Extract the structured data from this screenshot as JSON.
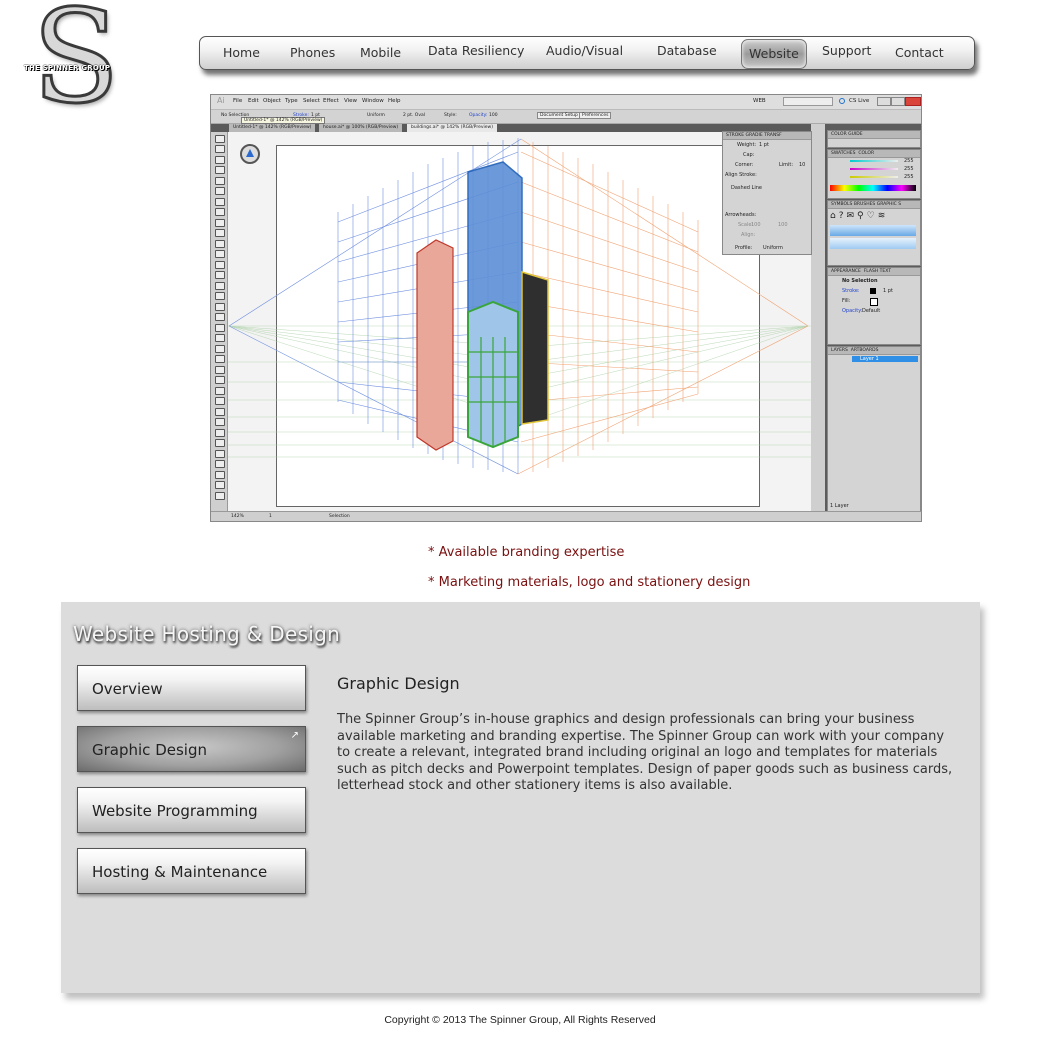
{
  "logo": {
    "letter": "S",
    "company_name": "THE SPINNER GROUP"
  },
  "nav": {
    "items": [
      {
        "label": "Home",
        "active": false
      },
      {
        "label": "Phones",
        "active": false
      },
      {
        "label": "Mobile",
        "active": false
      },
      {
        "label": "Data Resiliency",
        "active": false
      },
      {
        "label": "Audio/Visual",
        "active": false
      },
      {
        "label": "Database",
        "active": false
      },
      {
        "label": "Website",
        "active": true
      },
      {
        "label": "Support",
        "active": false
      },
      {
        "label": "Contact",
        "active": false
      }
    ]
  },
  "illustrator_screenshot": {
    "app_logo": "Ai",
    "menu": [
      "File",
      "Edit",
      "Object",
      "Type",
      "Select",
      "Effect",
      "View",
      "Window",
      "Help"
    ],
    "workspace": "WEB",
    "cs_live": "CS Live",
    "control_bar": {
      "selection": "No Selection",
      "stroke_label": "Stroke:",
      "stroke_weight": "1 pt",
      "profile": "Uniform",
      "brush": "2 pt. Oval",
      "style_label": "Style:",
      "opacity_label": "Opacity:",
      "opacity": "100",
      "document_setup": "Document Setup",
      "preferences": "Preferences"
    },
    "tooltip": "Untitled-1* @ 142% (RGB/Preview)",
    "doc_tabs": [
      "Untitled-1* @ 142% (RGB/Preview)",
      "house.ai* @ 100% (RGB/Preview)",
      "buildings.ai* @ 142% (RGB/Preview)"
    ],
    "stroke_panel": {
      "tabs": [
        "STROKE",
        "GRADIE",
        "TRANSF"
      ],
      "weight_label": "Weight:",
      "weight": "1 pt",
      "cap_label": "Cap:",
      "corner_label": "Corner:",
      "limit_label": "Limit:",
      "limit": "10",
      "align_label": "Align Stroke:",
      "dashed_label": "Dashed Line",
      "arrowheads_label": "Arrowheads:",
      "scale_label": "Scale:",
      "scale1": "100",
      "scale2": "100",
      "align2_label": "Align:",
      "profile_label": "Profile:",
      "profile": "Uniform"
    },
    "color_guide_tab": "COLOR GUIDE",
    "color_panel": {
      "tabs": [
        "SWATCHES",
        "COLOR"
      ],
      "r": "255",
      "g": "255",
      "b": "255"
    },
    "symbols_panel": {
      "tabs": [
        "SYMBOLS",
        "BRUSHES",
        "GRAPHIC S"
      ]
    },
    "appearance_panel": {
      "tabs": [
        "APPEARANCE",
        "FLASH TEXT"
      ],
      "selection": "No Selection",
      "stroke_label": "Stroke:",
      "stroke_value": "1 pt",
      "fill_label": "Fill:",
      "opacity_label": "Opacity:",
      "opacity_value": "Default"
    },
    "layers_panel": {
      "tabs": [
        "LAYERS",
        "ARTBOARDS"
      ],
      "layer_name": "Layer 1",
      "layer_count": "1 Layer"
    },
    "status_bar": {
      "zoom": "142%",
      "artboard": "1",
      "tool": "Selection"
    }
  },
  "bullets": [
    "* Available branding expertise",
    "* Marketing materials, logo and stationery design"
  ],
  "section": {
    "title": "Website Hosting & Design",
    "tabs": [
      {
        "label": "Overview",
        "active": false
      },
      {
        "label": "Graphic Design",
        "active": true
      },
      {
        "label": "Website Programming",
        "active": false
      },
      {
        "label": "Hosting & Maintenance",
        "active": false
      }
    ],
    "content_title": "Graphic Design",
    "content_body": "The Spinner Group’s in-house graphics and design professionals can bring your business available marketing and branding expertise. The Spinner Group can work with your company to create a relevant, integrated brand including original an logo and templates for materials such as  pitch decks and Powerpoint templates. Design of paper goods such as business cards, letterhead stock and other stationery items is also available."
  },
  "footer": {
    "copyright": "Copyright © 2013 The Spinner Group, All Rights Reserved"
  }
}
